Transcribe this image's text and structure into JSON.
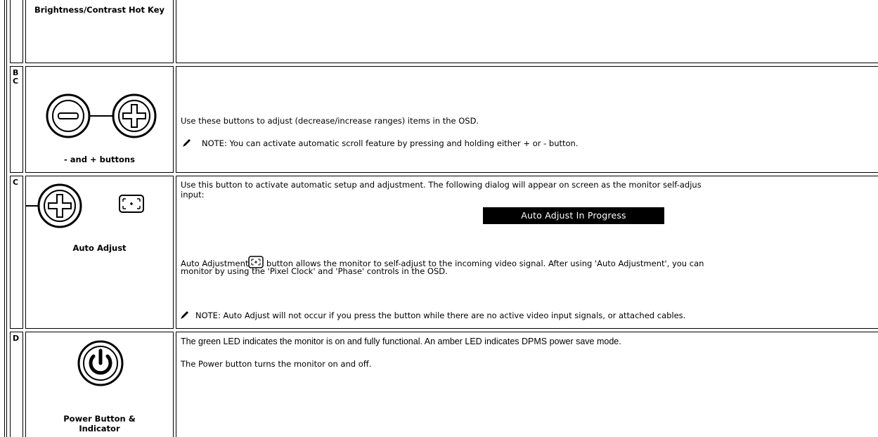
{
  "rows": [
    {
      "id": "brightness",
      "letter": "",
      "label": "Brightness/Contrast Hot Key",
      "paragraphs": []
    },
    {
      "id": "minus-plus",
      "letter": "B\nC",
      "label": "- and + buttons",
      "text": "Use these buttons to adjust (decrease/increase ranges) items in the OSD.",
      "note": "NOTE: You can activate automatic scroll feature by pressing and holding either + or - button."
    },
    {
      "id": "auto-adjust",
      "letter": "C",
      "label": "Auto Adjust",
      "text_line1": "Use this button to activate automatic setup and adjustment. The following dialog will appear on screen as the monitor self-adjus",
      "text_line2": "input:",
      "osd_message": "Auto Adjust In Progress",
      "para2_prefix": "Auto Adjustment",
      "para2_suffix": " button allows the monitor to self-adjust to the incoming video signal. After using 'Auto Adjustment', you can",
      "para2_line2": "monitor by using the 'Pixel Clock' and 'Phase' controls in the OSD.",
      "note": "NOTE: Auto Adjust will not occur if you press the button while there are no active video input signals, or attached cables."
    },
    {
      "id": "power",
      "letter": "D",
      "label_line1": "Power Button &",
      "label_line2": "Indicator",
      "text": "The green LED indicates the monitor is on and fully functional. An amber LED indicates DPMS power save mode.",
      "text2": "The Power button turns the monitor on and off."
    }
  ]
}
